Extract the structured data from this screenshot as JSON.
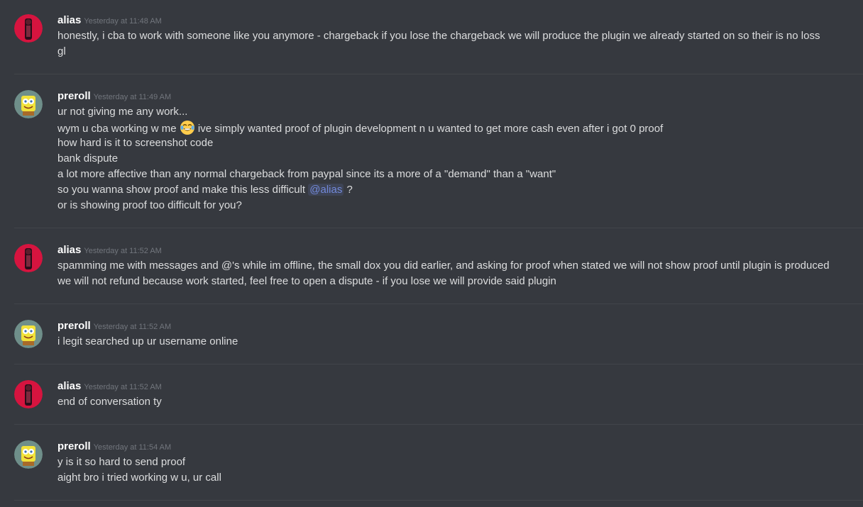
{
  "messages": [
    {
      "author": "alias",
      "timestamp": "Yesterday at 11:48 AM",
      "lines": [
        "honestly, i cba to work with someone like you anymore - chargeback if you lose the chargeback we will produce the plugin we already started on so their is no loss",
        "gl"
      ]
    },
    {
      "author": "preroll",
      "timestamp": "Yesterday at 11:49 AM",
      "lines": [
        "ur not giving me any work...",
        {
          "before": "wym u cba working w me ",
          "emoji": "joy-emoji",
          "after": " ive simply wanted proof of plugin development n u wanted to get more cash even after i got 0 proof"
        },
        "how hard is it to screenshot code",
        "bank dispute",
        "a lot more affective than any normal chargeback from paypal since its a more of a \"demand\" than a \"want\"",
        {
          "before": "so you wanna show proof and make this less difficult ",
          "mention": "@alias",
          "after": " ?"
        },
        "or is showing proof too difficult for you?"
      ]
    },
    {
      "author": "alias",
      "timestamp": "Yesterday at 11:52 AM",
      "lines": [
        "spamming me with messages and @'s while im offline, the small dox you did earlier, and asking for proof when stated we will not show proof until plugin is produced",
        "we will not refund because work started, feel free to open a dispute - if you lose we will provide said plugin"
      ]
    },
    {
      "author": "preroll",
      "timestamp": "Yesterday at 11:52 AM",
      "lines": [
        "i legit searched up ur username online"
      ]
    },
    {
      "author": "alias",
      "timestamp": "Yesterday at 11:52 AM",
      "lines": [
        "end of conversation ty"
      ]
    },
    {
      "author": "preroll",
      "timestamp": "Yesterday at 11:54 AM",
      "lines": [
        "y is it so hard to send proof",
        "aight bro i tried working w u, ur call"
      ]
    }
  ],
  "colors": {
    "background": "#36393f",
    "username": "#ffffff",
    "timestamp": "#72767d",
    "text": "#dcddde",
    "mention": "#7289da",
    "alias_avatar_bg": "#d6143f",
    "preroll_avatar_bg": "#6f8f8a"
  }
}
